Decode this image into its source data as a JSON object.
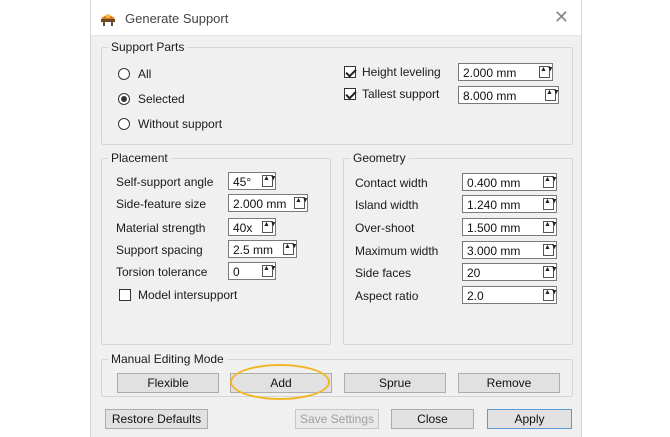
{
  "window": {
    "title": "Generate Support",
    "close_glyph": "✕",
    "icon": "support-app-icon"
  },
  "support_parts": {
    "title": "Support Parts",
    "radios": [
      {
        "label": "All",
        "checked": false
      },
      {
        "label": "Selected",
        "checked": true
      },
      {
        "label": "Without support",
        "checked": false
      }
    ],
    "height_leveling": {
      "label": "Height leveling",
      "checked": true,
      "value": "2.000 mm"
    },
    "tallest_support": {
      "label": "Tallest support",
      "checked": true,
      "value": "8.000 mm"
    }
  },
  "placement": {
    "title": "Placement",
    "fields": [
      {
        "label": "Self-support angle",
        "value": "45°"
      },
      {
        "label": "Side-feature size",
        "value": "2.000 mm"
      },
      {
        "label": "Material strength",
        "value": "40x"
      },
      {
        "label": "Support spacing",
        "value": "2.5 mm"
      },
      {
        "label": "Torsion tolerance",
        "value": "0"
      }
    ],
    "model_intersupport": {
      "label": "Model intersupport",
      "checked": false
    }
  },
  "geometry": {
    "title": "Geometry",
    "fields": [
      {
        "label": "Contact width",
        "value": "0.400 mm"
      },
      {
        "label": "Island width",
        "value": "1.240 mm"
      },
      {
        "label": "Over-shoot",
        "value": "1.500 mm"
      },
      {
        "label": "Maximum width",
        "value": "3.000 mm"
      },
      {
        "label": "Side faces",
        "value": "20"
      },
      {
        "label": "Aspect ratio",
        "value": "2.0"
      }
    ]
  },
  "manual_editing": {
    "title": "Manual Editing Mode",
    "buttons": [
      "Flexible",
      "Add",
      "Sprue",
      "Remove"
    ]
  },
  "footer": {
    "restore": "Restore Defaults",
    "save": "Save Settings",
    "close": "Close",
    "apply": "Apply"
  },
  "spinner_glyph": "▲▼",
  "colors": {
    "dialog_bg": "#f0f0f0",
    "annotation": "#f2b623",
    "border": "#d6d6d6"
  }
}
